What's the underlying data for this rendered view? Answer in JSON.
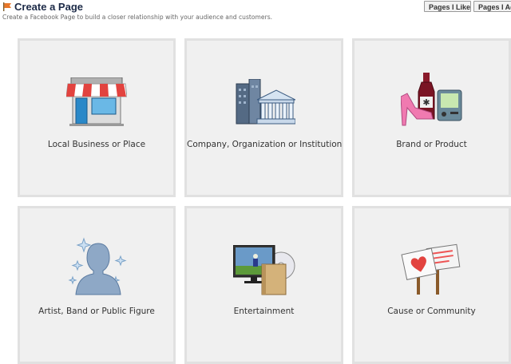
{
  "header": {
    "title": "Create a Page",
    "subtitle": "Create a Facebook Page to build a closer relationship with your audience and customers.",
    "buttons": {
      "pages_like": "Pages I Like",
      "pages_admin": "Pages I Ad"
    }
  },
  "categories": [
    {
      "label": "Local Business or Place",
      "icon": "storefront-icon"
    },
    {
      "label": "Company, Organization or Institution",
      "icon": "building-institution-icon"
    },
    {
      "label": "Brand or Product",
      "icon": "brand-product-icon"
    },
    {
      "label": "Artist, Band or Public Figure",
      "icon": "person-silhouette-icon"
    },
    {
      "label": "Entertainment",
      "icon": "tv-entertainment-icon"
    },
    {
      "label": "Cause or Community",
      "icon": "protest-signs-icon"
    }
  ],
  "colors": {
    "title": "#1c2a47",
    "card_bg": "#f0f0f0",
    "card_border": "#e1e1e1"
  }
}
